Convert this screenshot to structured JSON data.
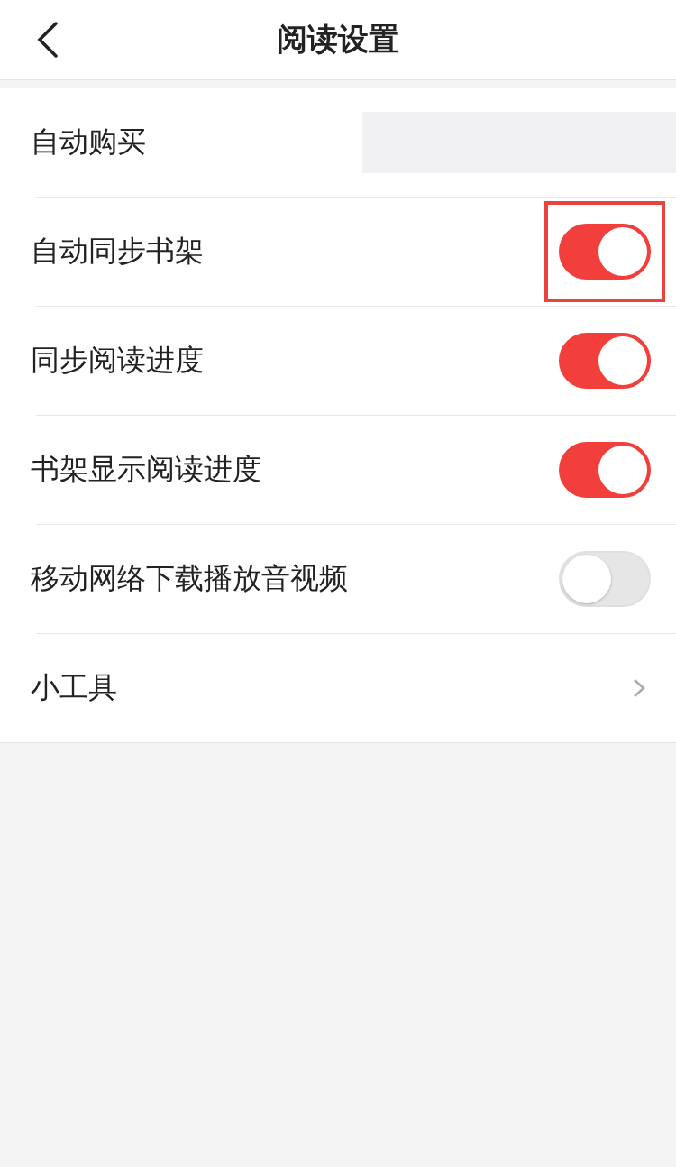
{
  "header": {
    "title": "阅读设置"
  },
  "rows": [
    {
      "label": "自动购买",
      "kind": "blank"
    },
    {
      "label": "自动同步书架",
      "kind": "toggle",
      "on": true,
      "highlighted": true
    },
    {
      "label": "同步阅读进度",
      "kind": "toggle",
      "on": true,
      "highlighted": false
    },
    {
      "label": "书架显示阅读进度",
      "kind": "toggle",
      "on": true,
      "highlighted": false
    },
    {
      "label": "移动网络下载播放音视频",
      "kind": "toggle",
      "on": false,
      "highlighted": false
    },
    {
      "label": "小工具",
      "kind": "link"
    }
  ]
}
